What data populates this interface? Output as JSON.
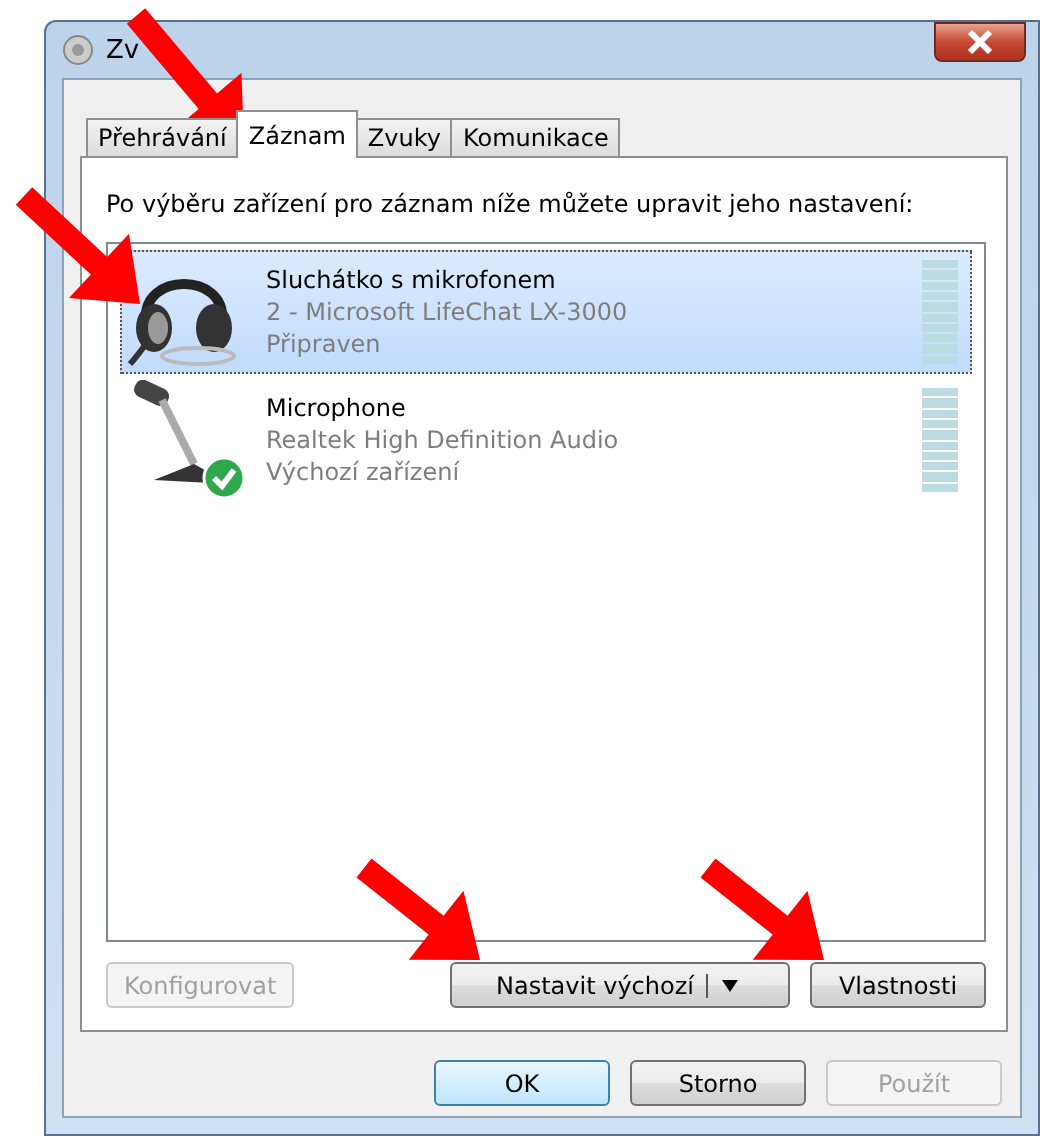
{
  "window": {
    "title": "Zv"
  },
  "tabs": [
    {
      "label": "Přehrávání",
      "selected": false
    },
    {
      "label": "Záznam",
      "selected": true
    },
    {
      "label": "Zvuky",
      "selected": false
    },
    {
      "label": "Komunikace",
      "selected": false
    }
  ],
  "instruction": "Po výběru zařízení pro záznam níže můžete upravit jeho nastavení:",
  "devices": [
    {
      "kind": "headset",
      "name": "Sluchátko s mikrofonem",
      "driver": "2 - Microsoft LifeChat LX-3000",
      "status": "Připraven",
      "selected": true,
      "default": false
    },
    {
      "kind": "microphone",
      "name": "Microphone",
      "driver": "Realtek High Definition Audio",
      "status": "Výchozí zařízení",
      "selected": false,
      "default": true
    }
  ],
  "panel_buttons": [
    {
      "kind": "plain",
      "label": "Konfigurovat",
      "disabled": true
    },
    {
      "kind": "split",
      "label": "Nastavit výchozí",
      "disabled": false
    },
    {
      "kind": "plain",
      "label": "Vlastnosti",
      "disabled": false
    }
  ],
  "dialog_buttons": [
    {
      "label": "OK",
      "disabled": false,
      "default": true
    },
    {
      "label": "Storno",
      "disabled": false,
      "default": false
    },
    {
      "label": "Použít",
      "disabled": true,
      "default": false
    }
  ]
}
